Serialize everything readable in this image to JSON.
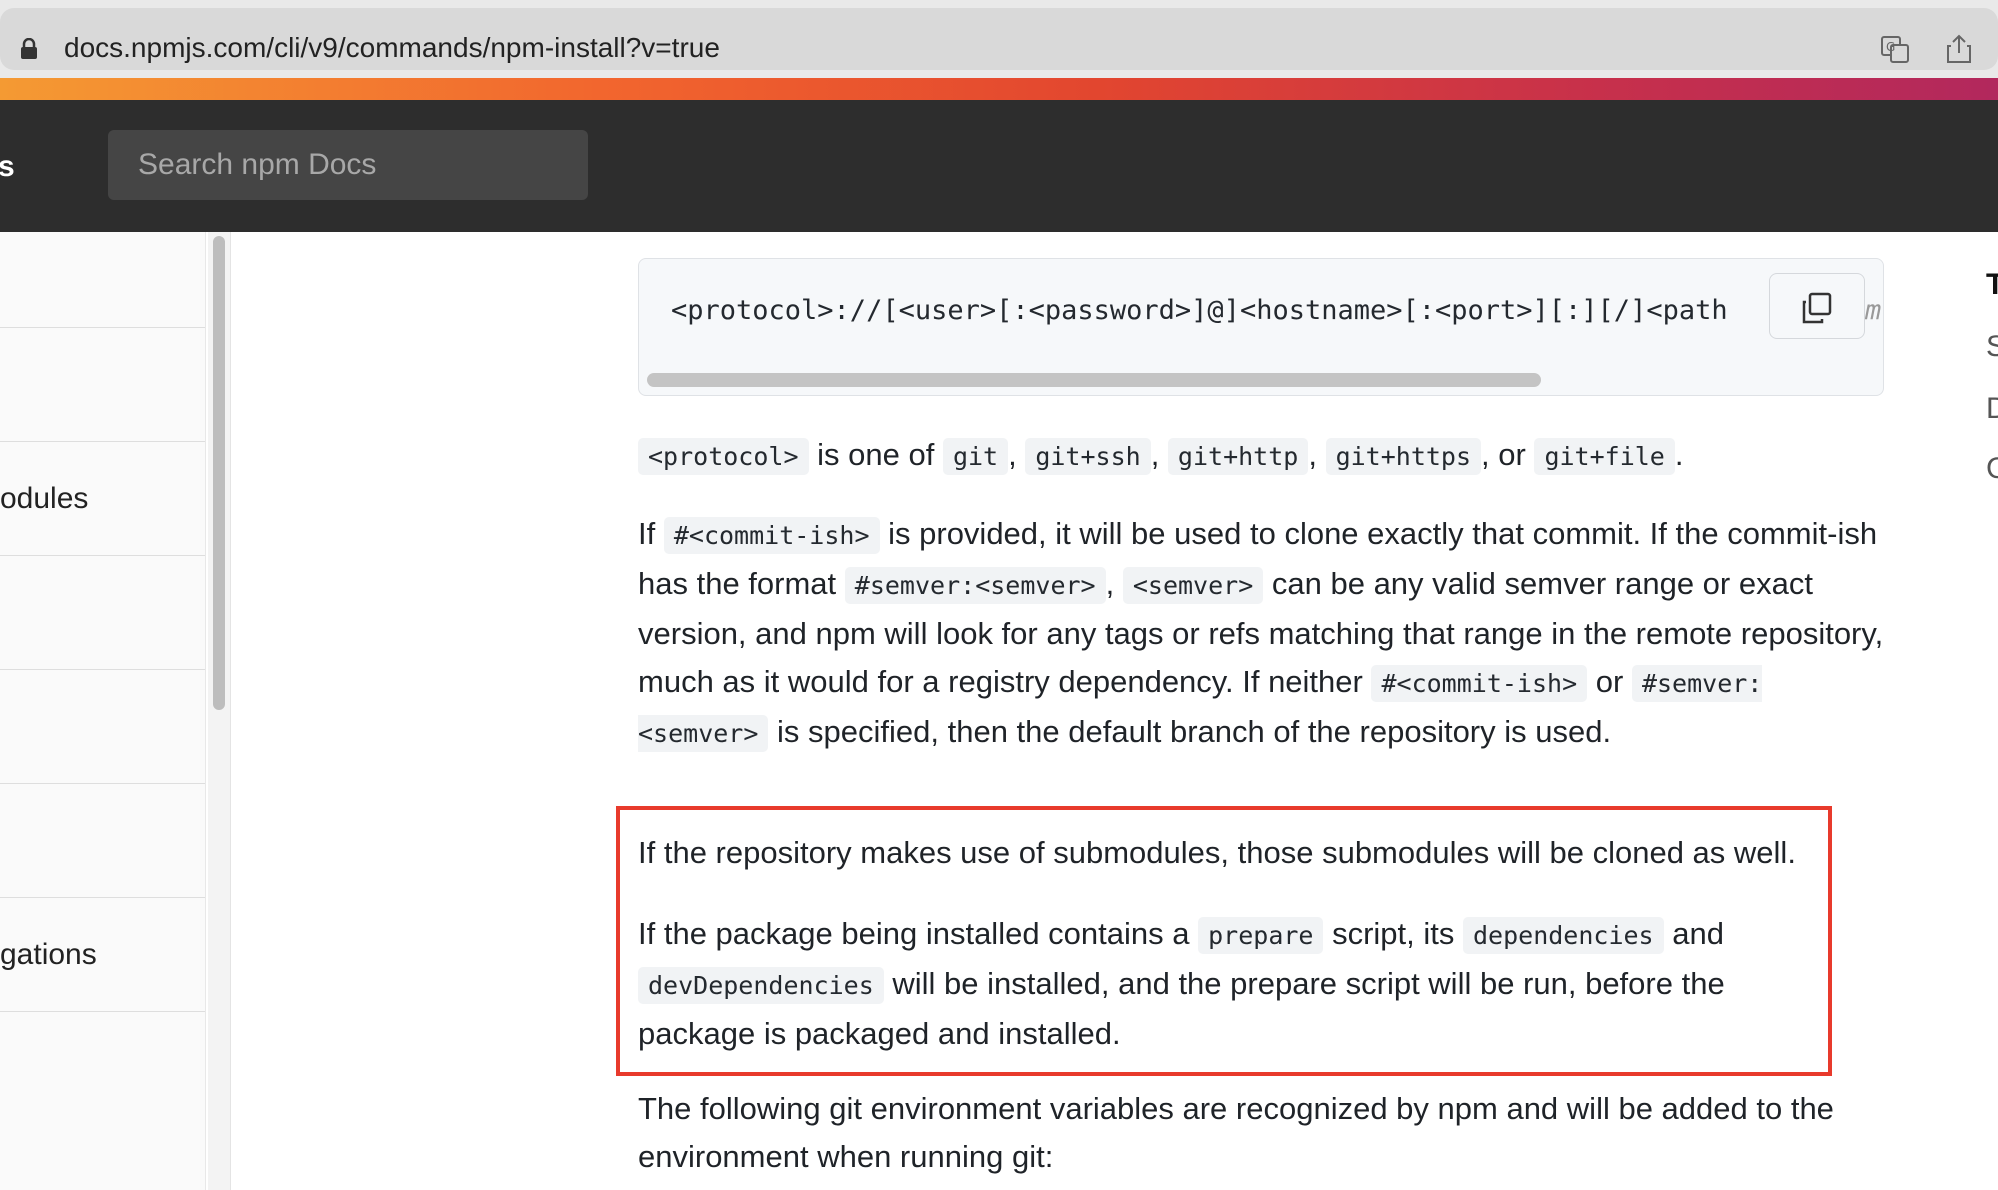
{
  "browser": {
    "url": "docs.npmjs.com/cli/v9/commands/npm-install?v=true"
  },
  "nav": {
    "brand_fragment": "s",
    "search_placeholder": "Search npm Docs"
  },
  "sidebar": {
    "items": [
      {
        "label": ""
      },
      {
        "label": ""
      },
      {
        "label": "odules"
      },
      {
        "label": ""
      },
      {
        "label": ""
      },
      {
        "label": ""
      },
      {
        "label": "gations"
      },
      {
        "label": ""
      }
    ]
  },
  "content": {
    "code_line": "<protocol>://[<user>[:<password>]@]<hostname>[:<port>][:][/]<path",
    "code_overflow": "m",
    "p1": {
      "protocol": "<protocol>",
      "t1": " is one of ",
      "git": "git",
      "git_ssh": "git+ssh",
      "git_http": "git+http",
      "git_https": "git+https",
      "or": ", or ",
      "git_file": "git+file",
      "end": "."
    },
    "p2": {
      "if": "If ",
      "commitish": "#<commit-ish>",
      "t1": " is provided, it will be used to clone exactly that commit. If the commit-ish has the format ",
      "semver_fmt": "#semver:<semver>",
      "semver": "<semver>",
      "t2": " can be any valid semver range or exact version, and npm will look for any tags or refs matching that range in the remote repository, much as it would for a registry dependency. If neither ",
      "commitish2": "#<commit-ish>",
      "or": " or ",
      "semver_fmt2": "#semver:<semver>",
      "t3": " is specified, then the default branch of the repository is used."
    },
    "p3": "If the repository makes use of submodules, those submodules will be cloned as well.",
    "p4": {
      "t1": "If the package being installed contains a ",
      "prepare": "prepare",
      "t2": " script, its ",
      "dependencies": "dependencies",
      "and": " and",
      "devdeps": "devDependencies",
      "t3": " will be installed, and the prepare script will be run, before the package is packaged and installed."
    },
    "p5": "The following git environment variables are recognized by npm and will be added to the environment when running git:"
  },
  "toc": {
    "letters": [
      "T",
      "S",
      "D",
      "C"
    ]
  },
  "colors": {
    "highlight_border": "#e83a2c",
    "nav_bg": "#2d2d2d"
  }
}
